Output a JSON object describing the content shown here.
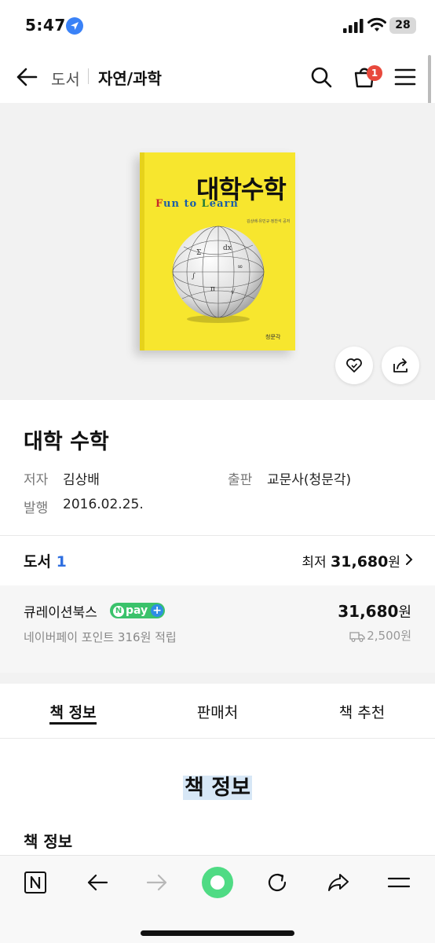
{
  "status_bar": {
    "time": "5:47",
    "battery": "28"
  },
  "header": {
    "breadcrumb_root": "도서",
    "breadcrumb_current": "자연/과학",
    "cart_count": "1"
  },
  "cover": {
    "title": "대학수학",
    "subtitle": "Fun to Learn",
    "authors": "김상배·유민규·정찬석 공저",
    "publisher": "청문각"
  },
  "book": {
    "title": "대학 수학",
    "author_label": "저자",
    "author": "김상배",
    "publisher_label": "출판",
    "publisher": "교문사(청문각)",
    "date_label": "발행",
    "date": "2016.02.25."
  },
  "stores": {
    "title": "도서",
    "count": "1",
    "lowest_label": "최저",
    "lowest_price": "31,680",
    "currency": "원"
  },
  "seller": {
    "name": "큐레이션북스",
    "npay_label": "pay",
    "point_text": "네이버페이 포인트 316원 적립",
    "price": "31,680",
    "currency": "원",
    "shipping": "2,500원"
  },
  "tabs": [
    {
      "label": "책 정보",
      "active": true
    },
    {
      "label": "판매처",
      "active": false
    },
    {
      "label": "책 추천",
      "active": false
    }
  ],
  "section": {
    "title": "책 정보",
    "subtitle": "책 정보"
  },
  "colors": {
    "accent": "#2f6fe0",
    "npay_green": "#3ac26b",
    "badge_red": "#e8493c",
    "book_yellow": "#f7e62e"
  },
  "bottom_bar_icons": [
    "naver-n-icon",
    "back-arrow-icon",
    "forward-arrow-icon",
    "green-home-icon",
    "refresh-icon",
    "share-icon",
    "menu-icon"
  ]
}
